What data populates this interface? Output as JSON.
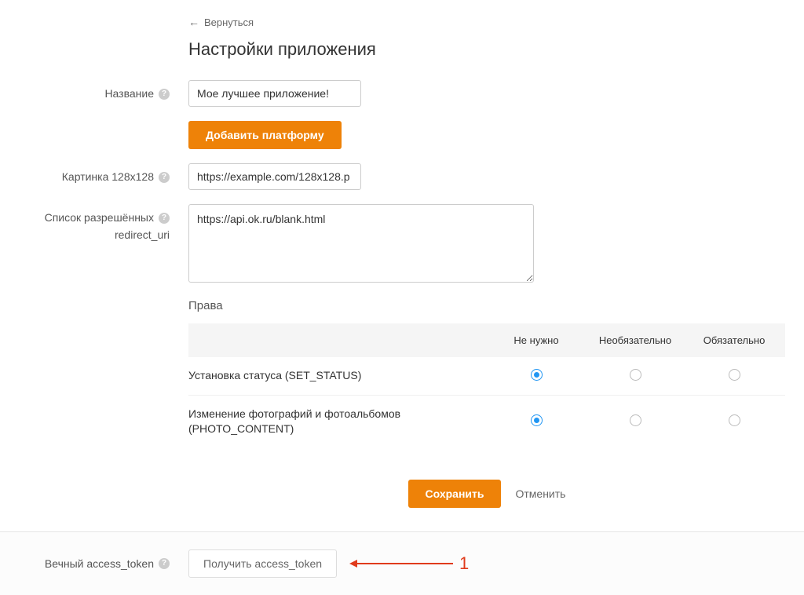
{
  "back_link": "Вернуться",
  "page_title": "Настройки приложения",
  "fields": {
    "name": {
      "label": "Название",
      "value": "Мое лучшее приложение!"
    },
    "add_platform_button": "Добавить платформу",
    "image": {
      "label": "Картинка 128x128",
      "value": "https://example.com/128x128.p"
    },
    "redirect": {
      "label_line1": "Список разрешённых",
      "label_line2": "redirect_uri",
      "value": "https://api.ok.ru/blank.html"
    }
  },
  "permissions": {
    "section_title": "Права",
    "columns": [
      "Не нужно",
      "Необязательно",
      "Обязательно"
    ],
    "rows": [
      {
        "name": "Установка статуса (SET_STATUS)",
        "selected": 0
      },
      {
        "name": "Изменение фотографий и фотоальбомов (PHOTO_CONTENT)",
        "selected": 0
      }
    ]
  },
  "actions": {
    "save": "Сохранить",
    "cancel": "Отменить"
  },
  "footer": {
    "label": "Вечный access_token",
    "button": "Получить access_token",
    "annotation_number": "1"
  }
}
